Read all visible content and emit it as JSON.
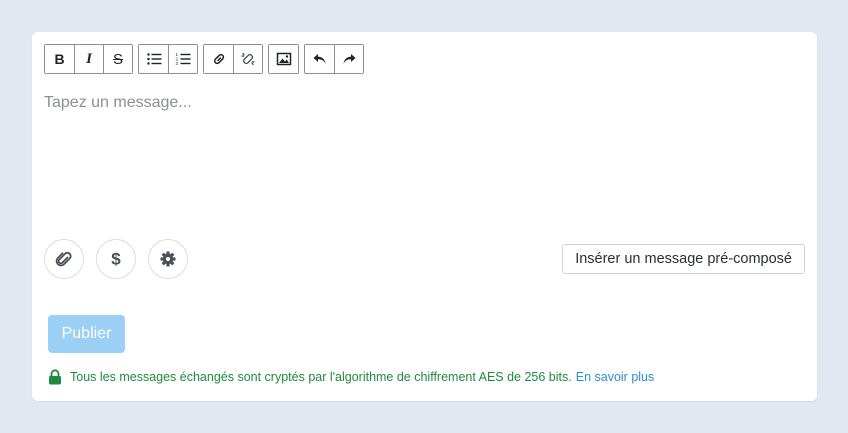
{
  "toolbar": {
    "bold_label": "B",
    "italic_label": "I",
    "strike_label": "S",
    "icons": [
      "bold-icon",
      "italic-icon",
      "strikethrough-icon",
      "bullet-list-icon",
      "numbered-list-icon",
      "link-icon",
      "unlink-icon",
      "image-icon",
      "undo-icon",
      "redo-icon"
    ]
  },
  "editor": {
    "placeholder": "Tapez un message..."
  },
  "actions": {
    "attach_icon": "paperclip-icon",
    "price_icon": "dollar-icon",
    "settings_icon": "gear-icon",
    "precomposed_label": "Insérer un message pré-composé"
  },
  "publish": {
    "label": "Publier"
  },
  "security": {
    "text": "Tous les messages échangés sont cryptés par l'algorithme de chiffrement AES de 256 bits.",
    "link": "En savoir plus"
  },
  "colors": {
    "background": "#e2e8f0",
    "publish_disabled": "#9ccff5",
    "security_green": "#1f8a3f",
    "link_blue": "#2a8ed0"
  }
}
